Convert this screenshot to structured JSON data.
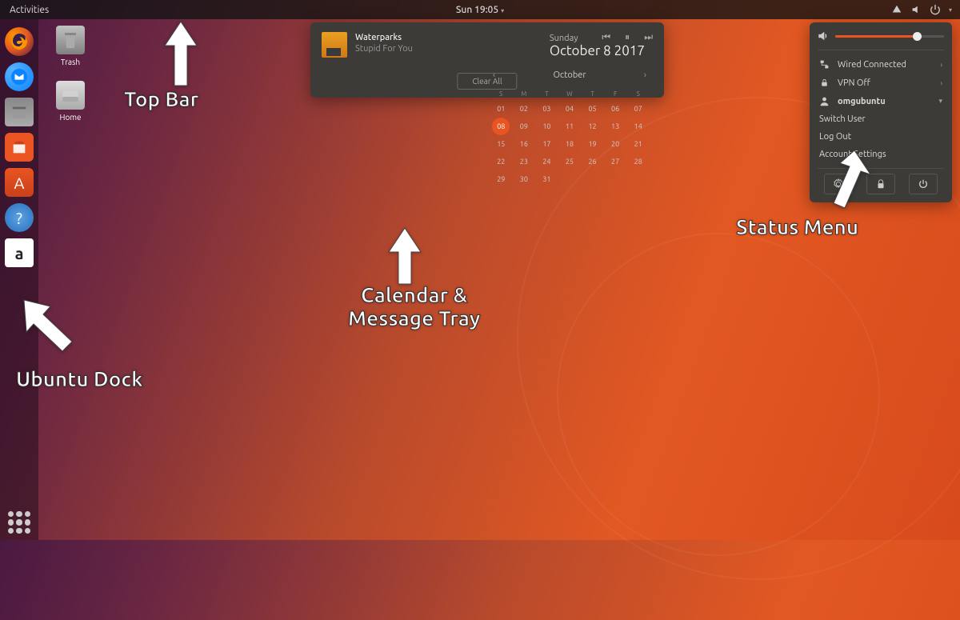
{
  "topbar": {
    "activities": "Activities",
    "clock": "Sun 19:05"
  },
  "desktop": {
    "trash": "Trash",
    "home": "Home"
  },
  "media": {
    "title": "Waterparks",
    "subtitle": "Stupid For You"
  },
  "date_display": {
    "dow": "Sunday",
    "fulldate": "October  8 2017"
  },
  "calendar": {
    "month": "October",
    "dows": [
      "S",
      "M",
      "T",
      "W",
      "T",
      "F",
      "S"
    ],
    "days": [
      {
        "n": "01",
        "f": false
      },
      {
        "n": "02",
        "f": false
      },
      {
        "n": "03",
        "f": false
      },
      {
        "n": "04",
        "f": false
      },
      {
        "n": "05",
        "f": false
      },
      {
        "n": "06",
        "f": false
      },
      {
        "n": "07",
        "f": false
      },
      {
        "n": "08",
        "f": false,
        "today": true
      },
      {
        "n": "09",
        "f": false
      },
      {
        "n": "10",
        "f": false
      },
      {
        "n": "11",
        "f": false
      },
      {
        "n": "12",
        "f": false
      },
      {
        "n": "13",
        "f": false
      },
      {
        "n": "14",
        "f": false
      },
      {
        "n": "15",
        "f": false
      },
      {
        "n": "16",
        "f": false
      },
      {
        "n": "17",
        "f": false
      },
      {
        "n": "18",
        "f": false
      },
      {
        "n": "19",
        "f": false
      },
      {
        "n": "20",
        "f": false
      },
      {
        "n": "21",
        "f": false
      },
      {
        "n": "22",
        "f": false
      },
      {
        "n": "23",
        "f": false
      },
      {
        "n": "24",
        "f": false
      },
      {
        "n": "25",
        "f": false
      },
      {
        "n": "26",
        "f": false
      },
      {
        "n": "27",
        "f": false
      },
      {
        "n": "28",
        "f": false
      },
      {
        "n": "29",
        "f": false
      },
      {
        "n": "30",
        "f": false
      },
      {
        "n": "31",
        "f": false
      }
    ],
    "leading_blanks": 0,
    "prev_month_days": [],
    "clear_all": "Clear All"
  },
  "status": {
    "wired": "Wired Connected",
    "vpn": "VPN Off",
    "user": "omgubuntu",
    "switch_user": "Switch User",
    "logout": "Log Out",
    "account": "Account Settings"
  },
  "annotations": {
    "topbar": "Top Bar",
    "calendar": "Calendar &\nMessage Tray",
    "status": "Status Menu",
    "dock": "Ubuntu Dock"
  },
  "colors": {
    "accent": "#e95420",
    "panel": "#3c3b37"
  }
}
